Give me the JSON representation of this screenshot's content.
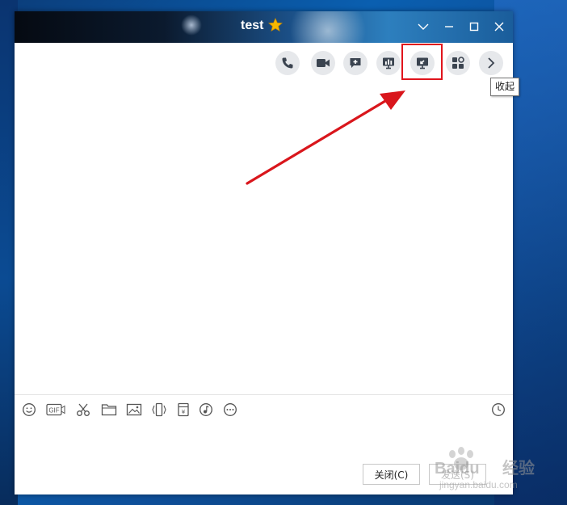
{
  "window": {
    "title": "test"
  },
  "toolbar": {
    "buttons": [
      {
        "name": "voice-call-button",
        "icon": "phone-icon"
      },
      {
        "name": "video-call-button",
        "icon": "video-camera-icon"
      },
      {
        "name": "chat-plus-button",
        "icon": "chat-plus-icon"
      },
      {
        "name": "presentation-button",
        "icon": "presentation-icon"
      },
      {
        "name": "screen-share-button",
        "icon": "screen-share-icon"
      },
      {
        "name": "apps-button",
        "icon": "apps-icon"
      },
      {
        "name": "collapse-button",
        "icon": "chevron-right-icon"
      }
    ]
  },
  "tooltip": {
    "text": "收起"
  },
  "input_toolbar": {
    "icons": [
      "smiley-icon",
      "gif-icon",
      "scissors-icon",
      "folder-icon",
      "image-icon",
      "shake-icon",
      "red-packet-icon",
      "music-icon",
      "more-icon"
    ],
    "gif_label": "GIF",
    "history_icon": "clock-icon"
  },
  "footer": {
    "close_label": "关闭(C)",
    "send_label": "发送(S)"
  },
  "watermark": {
    "brand": "Baidu",
    "suffix": "经验",
    "url": "jingyan.baidu.com"
  },
  "colors": {
    "highlight": "#e0141c",
    "arrow": "#d9161c",
    "star": "#f5b800"
  }
}
